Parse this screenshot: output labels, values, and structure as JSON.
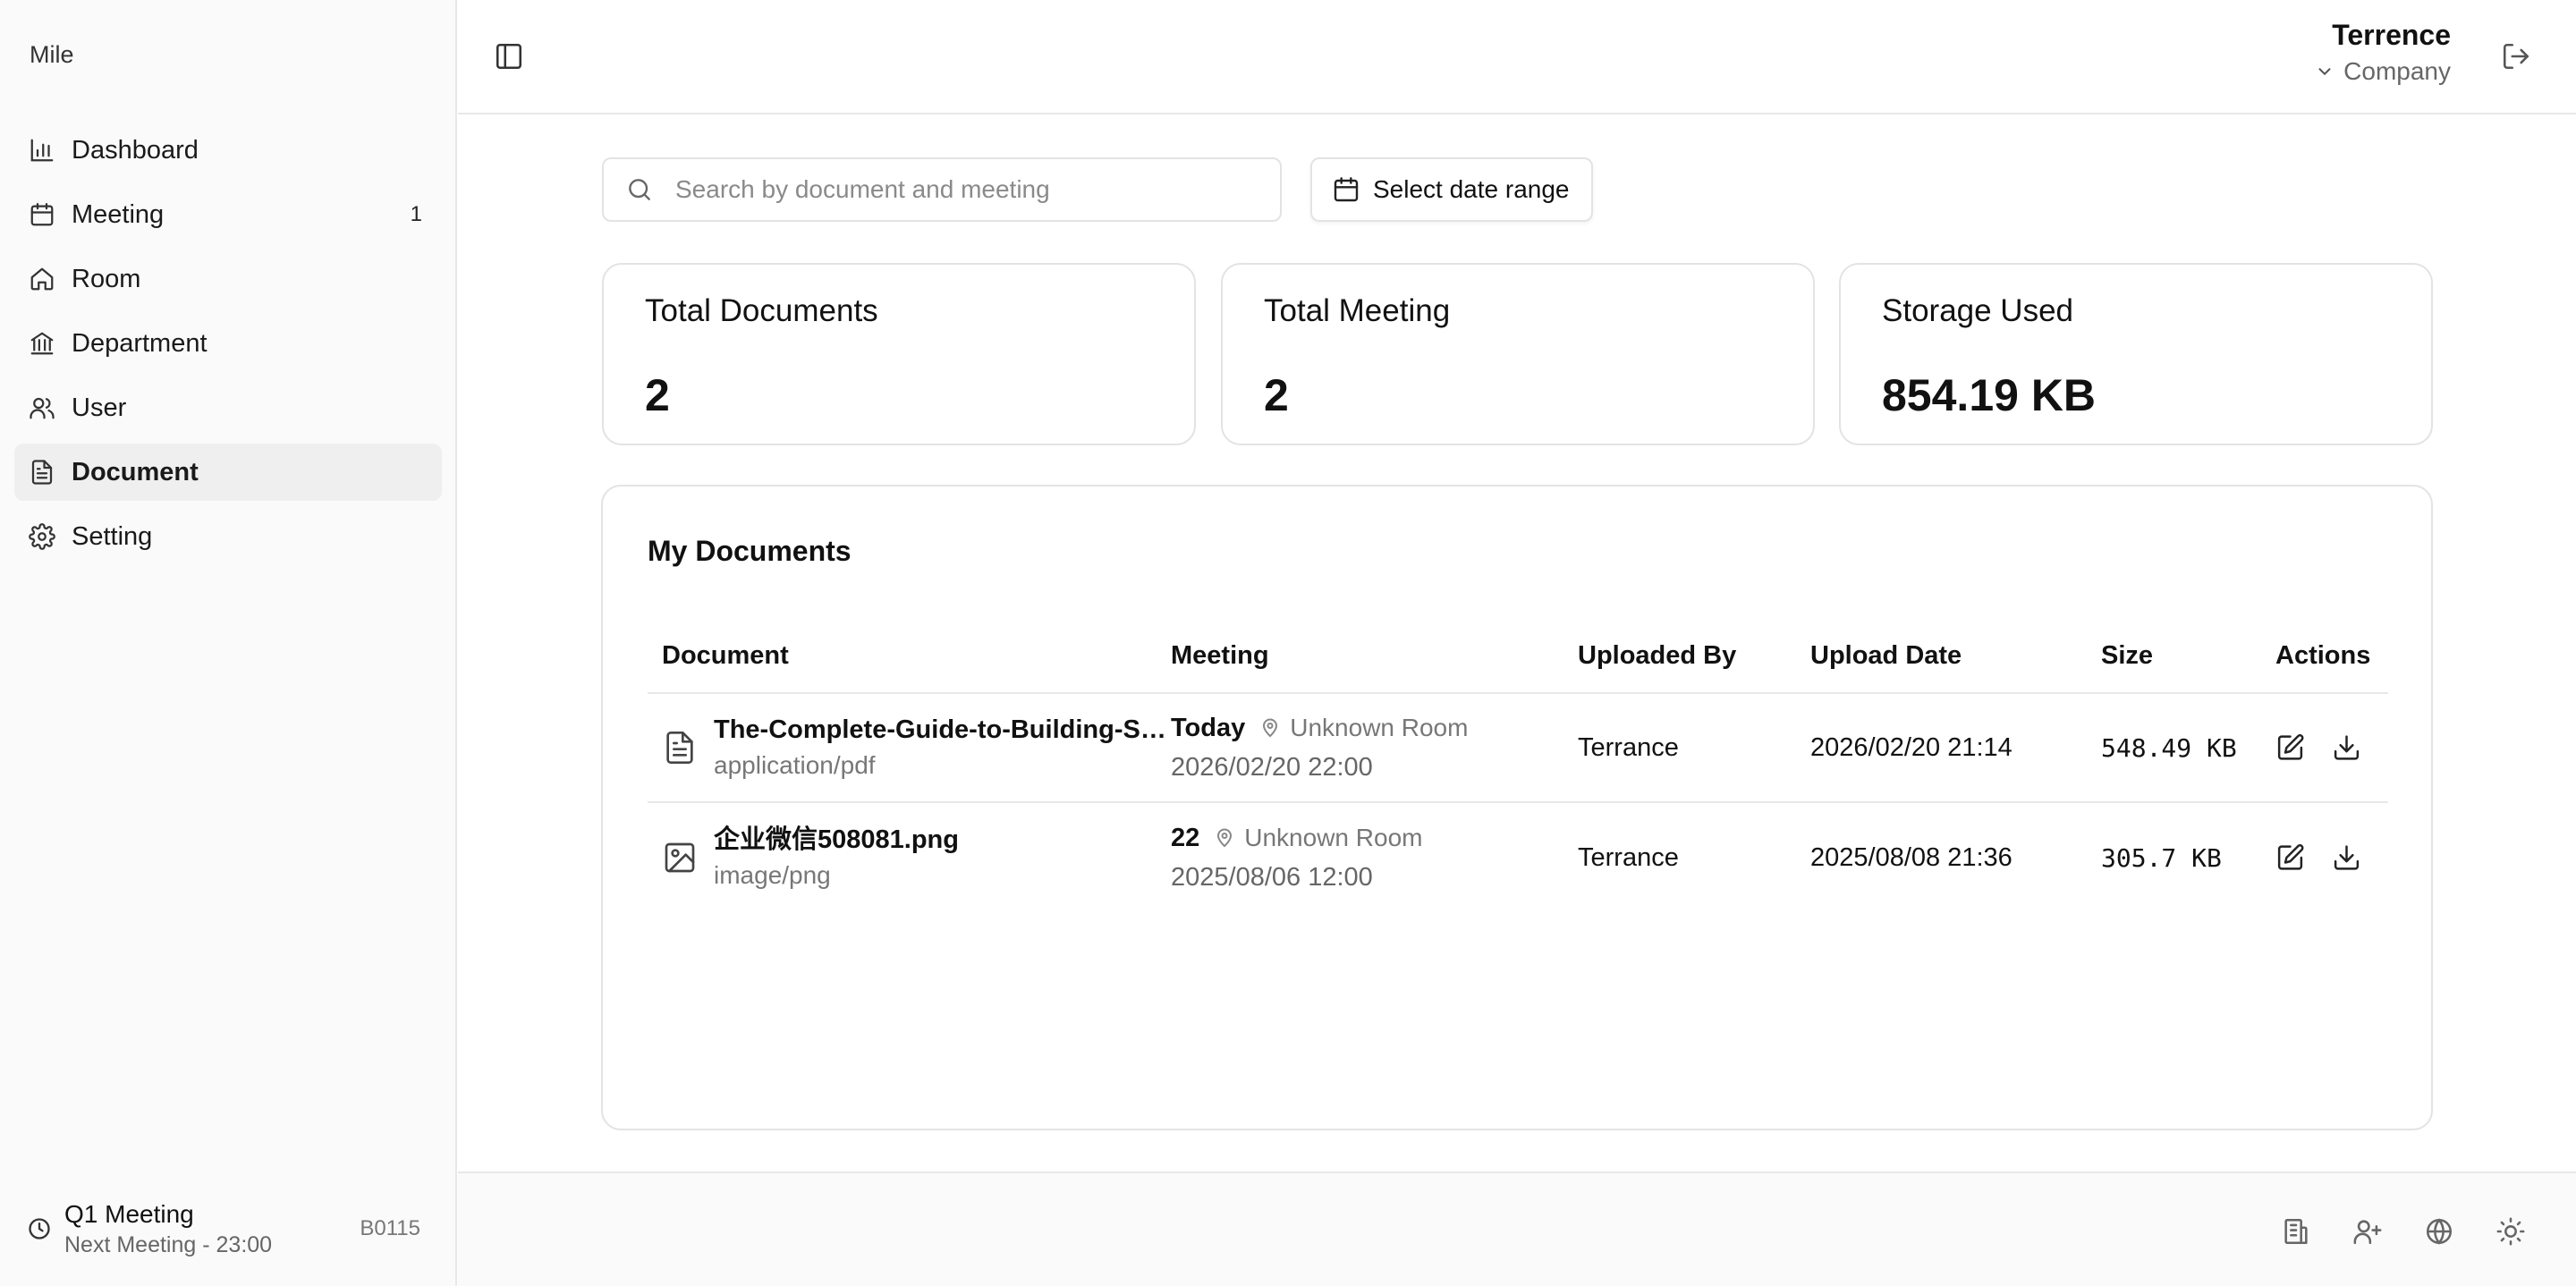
{
  "app": {
    "brand": "Mile"
  },
  "sidebar": {
    "items": [
      {
        "label": "Dashboard",
        "icon": "bar-chart-icon"
      },
      {
        "label": "Meeting",
        "icon": "calendar-icon",
        "count": "1"
      },
      {
        "label": "Room",
        "icon": "home-icon"
      },
      {
        "label": "Department",
        "icon": "building-icon"
      },
      {
        "label": "User",
        "icon": "users-icon"
      },
      {
        "label": "Document",
        "icon": "file-text-icon",
        "active": true
      },
      {
        "label": "Setting",
        "icon": "gear-icon"
      }
    ],
    "next_meeting": {
      "title": "Q1 Meeting",
      "subtitle": "Next Meeting - 23:00",
      "code": "B0115"
    }
  },
  "header": {
    "user_name": "Terrence",
    "company": "Company"
  },
  "search": {
    "placeholder": "Search by document and meeting",
    "value": ""
  },
  "date_range": {
    "label": "Select date range"
  },
  "stats": {
    "total_documents": {
      "label": "Total Documents",
      "value": "2"
    },
    "total_meeting": {
      "label": "Total Meeting",
      "value": "2"
    },
    "storage_used": {
      "label": "Storage Used",
      "value": "854.19 KB"
    }
  },
  "documents": {
    "title": "My Documents",
    "columns": [
      "Document",
      "Meeting",
      "Uploaded By",
      "Upload Date",
      "Size",
      "Actions"
    ],
    "rows": [
      {
        "name": "The-Complete-Guide-to-Building-Sk...",
        "type": "application/pdf",
        "icon": "file-text-icon",
        "meeting_day": "Today",
        "meeting_room": "Unknown Room",
        "meeting_time": "2026/02/20 22:00",
        "uploaded_by": "Terrance",
        "upload_date": "2026/02/20 21:14",
        "size": "548.49 KB"
      },
      {
        "name": "企业微信508081.png",
        "type": "image/png",
        "icon": "image-icon",
        "meeting_day": "22",
        "meeting_room": "Unknown Room",
        "meeting_time": "2025/08/06 12:00",
        "uploaded_by": "Terrance",
        "upload_date": "2025/08/08 21:36",
        "size": "305.7 KB"
      }
    ]
  },
  "footer": {
    "icons": [
      "building-icon",
      "user-plus-icon",
      "globe-icon",
      "sun-icon"
    ]
  }
}
